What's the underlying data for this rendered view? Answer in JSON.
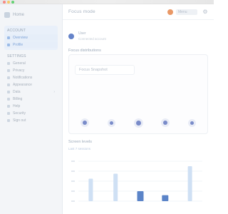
{
  "window": {
    "traffic": [
      "#ff5f57",
      "#febc2e",
      "#28c840"
    ]
  },
  "sidebar": {
    "app_name": "Home",
    "section_primary": "Account",
    "primary_items": [
      {
        "label": "Overview",
        "icon": "grid-icon"
      },
      {
        "label": "Profile",
        "icon": "user-icon"
      }
    ],
    "section_secondary": "Settings",
    "items": [
      {
        "label": "General",
        "icon": "home-icon"
      },
      {
        "label": "Privacy",
        "icon": "shield-icon"
      },
      {
        "label": "Notifications",
        "icon": "bell-icon"
      },
      {
        "label": "Appearance",
        "icon": "palette-icon"
      },
      {
        "label": "Data",
        "icon": "database-icon",
        "chevron": "›"
      },
      {
        "label": "Billing",
        "icon": "card-icon"
      },
      {
        "label": "Help",
        "icon": "help-icon"
      },
      {
        "label": "Security",
        "icon": "lock-icon"
      },
      {
        "label": "Sign out",
        "icon": "logout-icon"
      }
    ]
  },
  "header": {
    "title": "Focus mode",
    "menu_label": "Menu",
    "settings_glyph": "⚙",
    "avatar_color": "#e5864b"
  },
  "user": {
    "name": "User",
    "subtitle": "Connected account"
  },
  "focus_card": {
    "title": "Focus distributions",
    "search_placeholder": "Focus Snapshot",
    "dots": [
      {
        "size": 6
      },
      {
        "size": 5
      },
      {
        "size": 7
      },
      {
        "size": 6
      },
      {
        "size": 5
      }
    ],
    "dot_color": "#6b7fc4"
  },
  "chart_card": {
    "title": "Screen levels",
    "subtitle": "Last 7 sessions"
  },
  "chart_data": {
    "type": "bar",
    "categories": [
      "1",
      "2",
      "3",
      "4",
      "5"
    ],
    "values": [
      45,
      55,
      20,
      12,
      70
    ],
    "highlight": [
      false,
      false,
      true,
      true,
      false
    ],
    "ylim": [
      0,
      80
    ],
    "grid": true,
    "title": "",
    "xlabel": "",
    "ylabel": "",
    "colors": {
      "bar": "#cfe0f4",
      "highlight": "#5b84c8",
      "grid": "#eef2f7"
    }
  }
}
